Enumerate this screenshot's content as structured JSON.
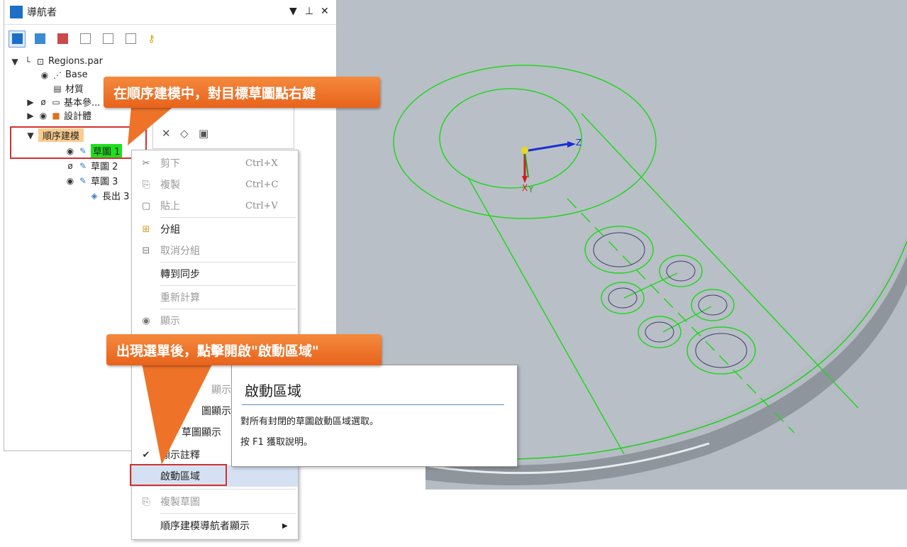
{
  "navigator": {
    "title": "導航者",
    "pin_icon": "pin-icon",
    "dropdown_icon": "dropdown-icon",
    "close_icon": "close-icon",
    "tree": {
      "root": "Regions.par",
      "base": "Base",
      "material": "材質",
      "basic": "基本參...",
      "design_body": "設計體",
      "ordered": "順序建模",
      "sketch1": "草圖 1",
      "sketch2": "草圖 2",
      "sketch3": "草圖 3",
      "extrude": "長出 3"
    }
  },
  "context_menu": {
    "cut": "剪下",
    "cut_sc": "Ctrl+X",
    "copy": "複製",
    "copy_sc": "Ctrl+C",
    "paste": "貼上",
    "paste_sc": "Ctrl+V",
    "group": "分組",
    "ungroup": "取消分組",
    "to_sync": "轉到同步",
    "recompute": "重新計算",
    "show": "顯示",
    "partial1": "顯示",
    "partial2": "圖顯示",
    "partial3": "草圖顯示",
    "show_annotation": "顯示註釋",
    "enable_regions": "啟動區域",
    "copy_sketch": "複製草圖",
    "ordered_nav_display": "順序建模導航者顯示"
  },
  "tooltip": {
    "title": "啟動區域",
    "description": "對所有封閉的草圖啟動區域選取。",
    "help": "按 F1 獲取說明。"
  },
  "callouts": {
    "top": "在順序建模中，對目標草圖點右鍵",
    "bottom": "出現選單後，點擊開啟\"啟動區域\""
  },
  "viewport": {
    "axis_z": "Z",
    "axis_x": "X",
    "axis_y": "Y"
  },
  "colors": {
    "accent": "#f07a2e",
    "sketch": "#22d622",
    "highlight_box": "#d43030"
  }
}
